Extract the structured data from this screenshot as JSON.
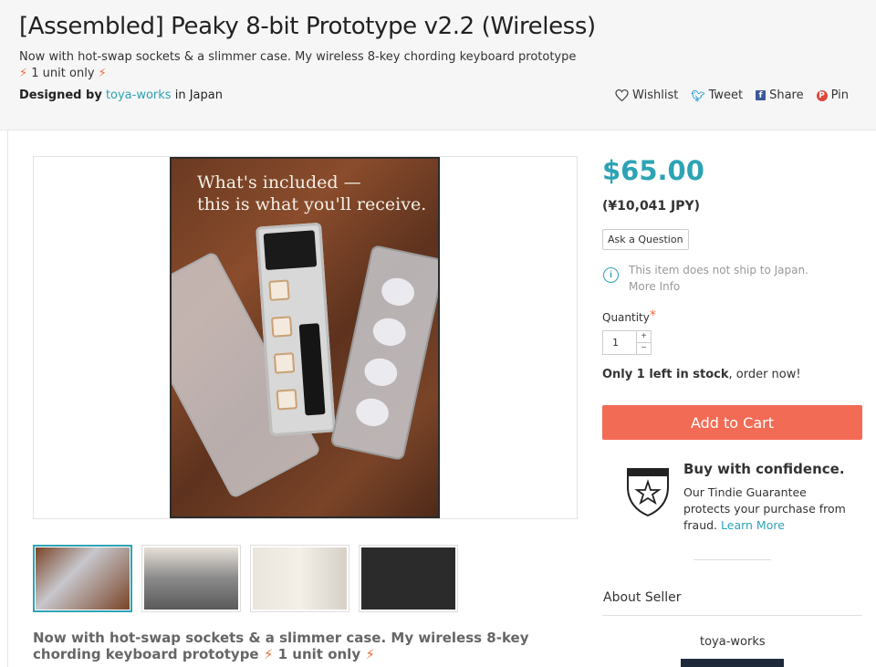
{
  "header": {
    "title": "[Assembled] Peaky 8-bit Prototype v2.2 (Wireless)",
    "subtitle_a": "Now with hot-swap sockets & a slimmer case. My wireless 8-key chording keyboard prototype",
    "subtitle_b": "1 unit",
    "subtitle_c": "only",
    "bolt": "⚡",
    "designed_by_label": "Designed by",
    "designer": "toya-works",
    "location": "in Japan"
  },
  "social": {
    "wishlist": "Wishlist",
    "tweet": "Tweet",
    "share": "Share",
    "pin": "Pin"
  },
  "product_image": {
    "caption_line1": "What's included —",
    "caption_line2": "this is what you'll receive."
  },
  "description": {
    "text_a": "Now with hot-swap sockets & a slimmer case. My wireless 8-key chording keyboard prototype",
    "text_b": "1 unit only"
  },
  "purchase": {
    "price": "$65.00",
    "price_jpy": "(¥10,041 JPY)",
    "ask_question": "Ask a Question",
    "ship_notice": "This item does not ship to Japan.",
    "more_info": "More Info",
    "quantity_label": "Quantity",
    "required_mark": "*",
    "quantity_value": "1",
    "stock_bold": "Only 1 left in stock",
    "stock_rest": ", order now!",
    "add_to_cart": "Add to Cart"
  },
  "guarantee": {
    "title": "Buy with confidence.",
    "text": "Our Tindie Guarantee protects your purchase from fraud.",
    "learn_more": "Learn More"
  },
  "seller": {
    "about_label": "About Seller",
    "name": "toya-works"
  },
  "colors": {
    "accent": "#2da3b5",
    "cart": "#f26b55",
    "bolt": "#f26b3a"
  }
}
